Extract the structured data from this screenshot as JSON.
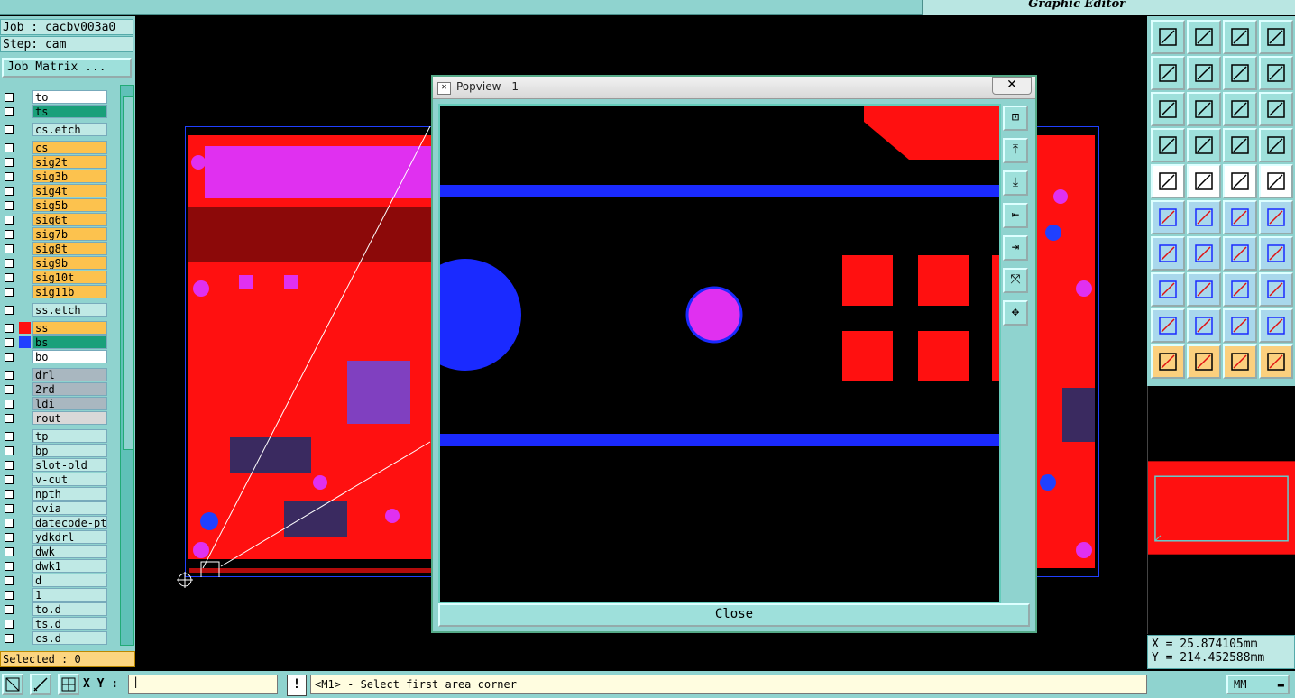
{
  "header": {
    "subtitle": "Graphic Editor"
  },
  "job": {
    "job_line": "Job : cacbv003a0",
    "step_line": "Step: cam",
    "matrix_button": "Job Matrix ..."
  },
  "layers": [
    {
      "name": "to",
      "color": "#ffffff",
      "swatch": ""
    },
    {
      "name": "ts",
      "color": "#1aa07a",
      "swatch": ""
    },
    {
      "name": "cs.etch",
      "color": "#bfe9e5",
      "swatch": ""
    },
    {
      "name": "cs",
      "color": "#fcc24e",
      "swatch": ""
    },
    {
      "name": "sig2t",
      "color": "#fcc24e",
      "swatch": ""
    },
    {
      "name": "sig3b",
      "color": "#fcc24e",
      "swatch": ""
    },
    {
      "name": "sig4t",
      "color": "#fcc24e",
      "swatch": ""
    },
    {
      "name": "sig5b",
      "color": "#fcc24e",
      "swatch": ""
    },
    {
      "name": "sig6t",
      "color": "#fcc24e",
      "swatch": ""
    },
    {
      "name": "sig7b",
      "color": "#fcc24e",
      "swatch": ""
    },
    {
      "name": "sig8t",
      "color": "#fcc24e",
      "swatch": ""
    },
    {
      "name": "sig9b",
      "color": "#fcc24e",
      "swatch": ""
    },
    {
      "name": "sig10t",
      "color": "#fcc24e",
      "swatch": ""
    },
    {
      "name": "sig11b",
      "color": "#fcc24e",
      "swatch": ""
    },
    {
      "name": "ss.etch",
      "color": "#bfe9e5",
      "swatch": ""
    },
    {
      "name": "ss",
      "color": "#fcc24e",
      "swatch": "#ff1010"
    },
    {
      "name": "bs",
      "color": "#1aa07a",
      "swatch": "#2040ff"
    },
    {
      "name": "bo",
      "color": "#ffffff",
      "swatch": ""
    },
    {
      "name": "drl",
      "color": "#a9b7c0",
      "swatch": ""
    },
    {
      "name": "2rd",
      "color": "#a9b7c0",
      "swatch": ""
    },
    {
      "name": "ldi",
      "color": "#a9b7c0",
      "swatch": ""
    },
    {
      "name": "rout",
      "color": "#d8d8d8",
      "swatch": ""
    },
    {
      "name": "tp",
      "color": "#bfe9e5",
      "swatch": ""
    },
    {
      "name": "bp",
      "color": "#bfe9e5",
      "swatch": ""
    },
    {
      "name": "slot-old",
      "color": "#bfe9e5",
      "swatch": ""
    },
    {
      "name": "v-cut",
      "color": "#bfe9e5",
      "swatch": ""
    },
    {
      "name": "npth",
      "color": "#bfe9e5",
      "swatch": ""
    },
    {
      "name": "cvia",
      "color": "#bfe9e5",
      "swatch": ""
    },
    {
      "name": "datecode-pt",
      "color": "#bfe9e5",
      "swatch": ""
    },
    {
      "name": "ydkdrl",
      "color": "#bfe9e5",
      "swatch": ""
    },
    {
      "name": "dwk",
      "color": "#bfe9e5",
      "swatch": ""
    },
    {
      "name": "dwk1",
      "color": "#bfe9e5",
      "swatch": ""
    },
    {
      "name": "d",
      "color": "#bfe9e5",
      "swatch": ""
    },
    {
      "name": "1",
      "color": "#bfe9e5",
      "swatch": ""
    },
    {
      "name": "to.d",
      "color": "#bfe9e5",
      "swatch": ""
    },
    {
      "name": "ts.d",
      "color": "#bfe9e5",
      "swatch": ""
    },
    {
      "name": "cs.d",
      "color": "#bfe9e5",
      "swatch": ""
    }
  ],
  "status": {
    "selected": "Selected : 0"
  },
  "popview": {
    "title": "Popview - 1",
    "close_x": "✕",
    "close_button": "Close"
  },
  "coords": {
    "x": "X = 25.874105mm",
    "y": "Y = 214.452588mm"
  },
  "bottom": {
    "xy_label": "X Y :",
    "warn": "!",
    "message": "<M1> - Select first area corner",
    "units": "MM"
  },
  "colors": {
    "panel": "#8fd3cf",
    "copper": "#ff0000",
    "pad_magenta": "#e030f0",
    "trace_blue": "#1a2aff"
  }
}
